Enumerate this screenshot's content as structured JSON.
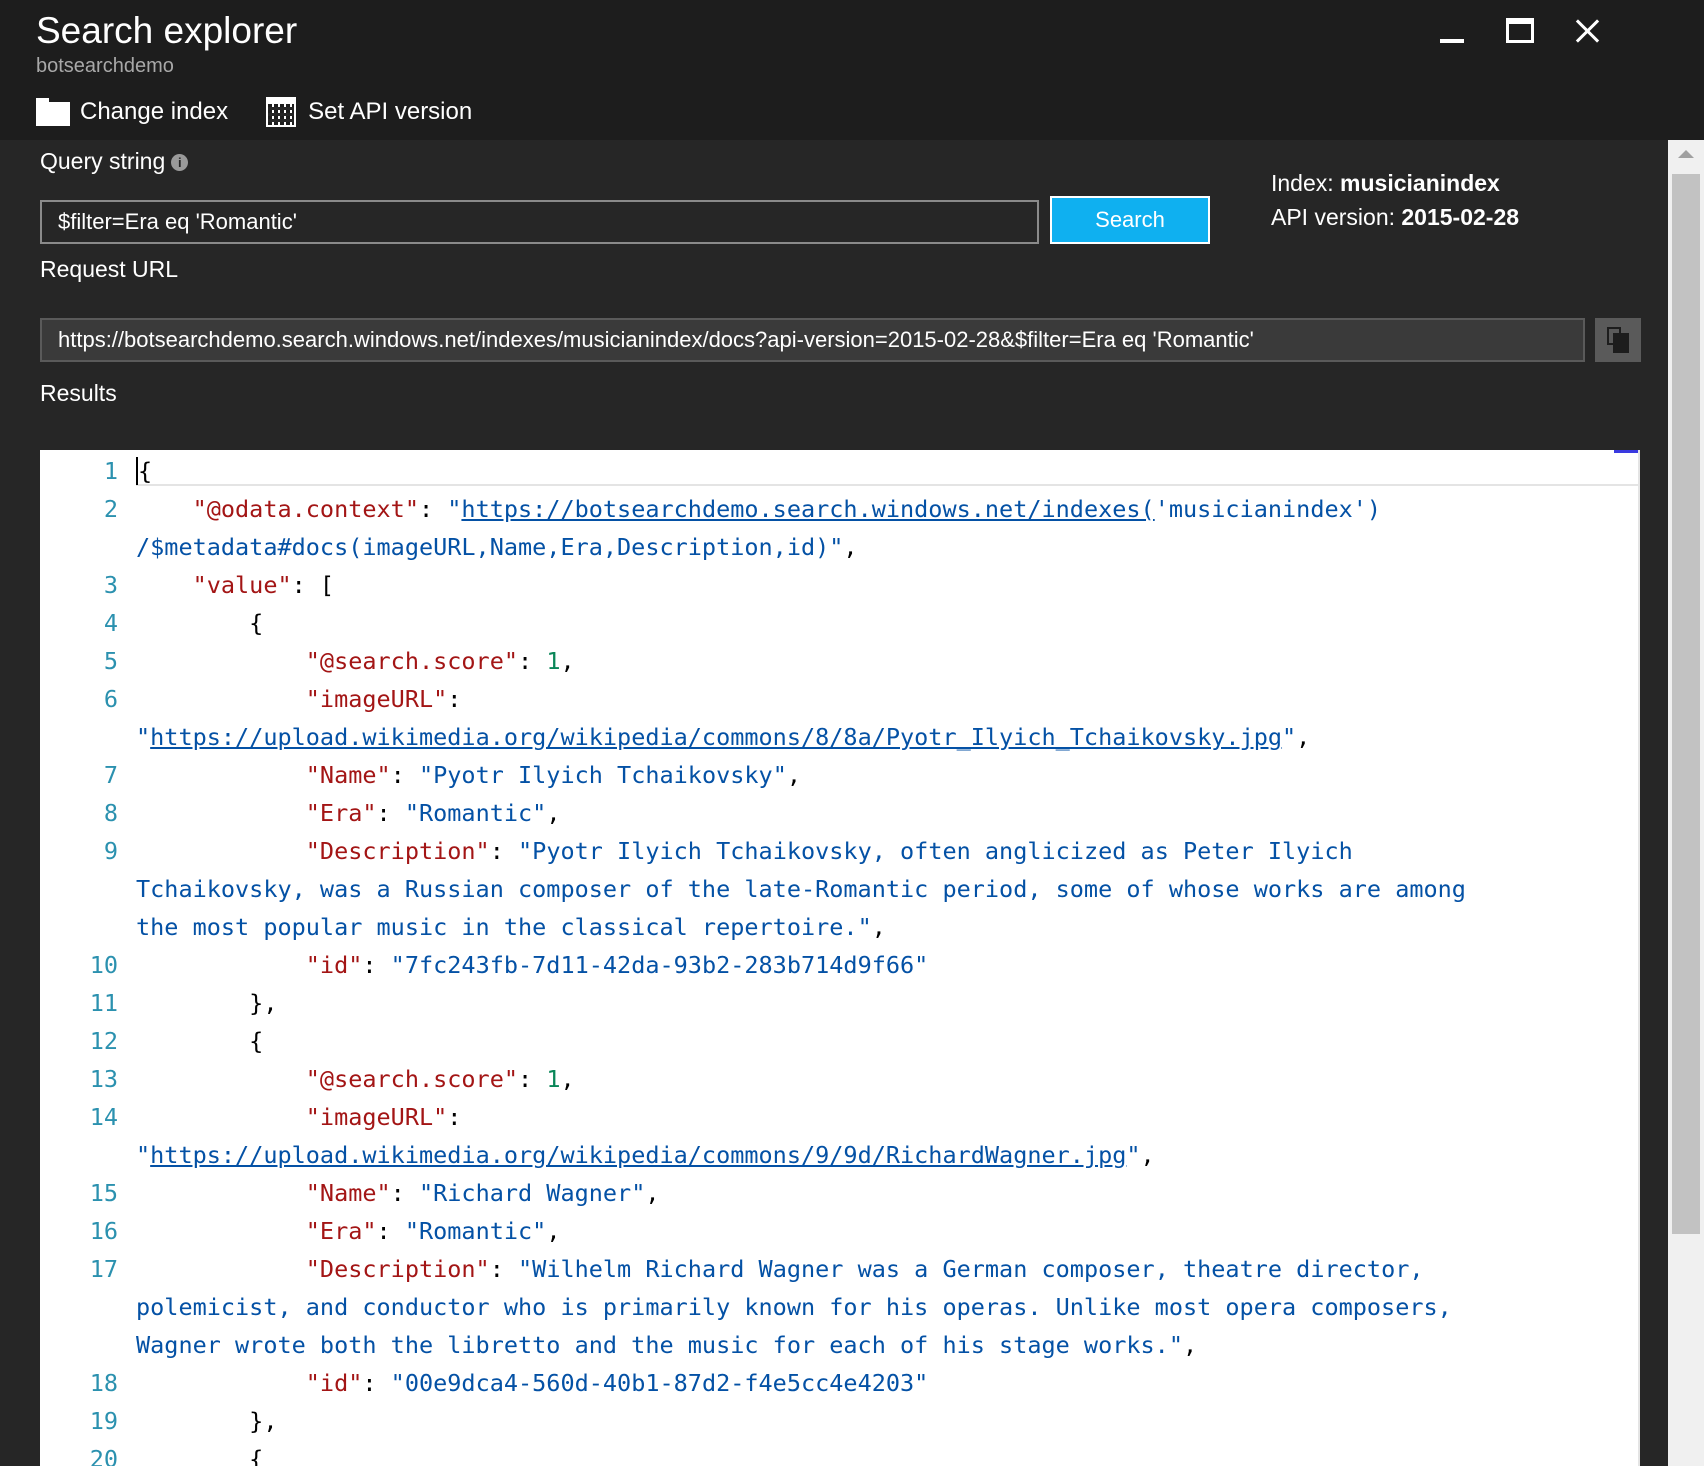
{
  "window": {
    "title": "Search explorer",
    "subtitle": "botsearchdemo",
    "controls": [
      "minimize-icon",
      "maximize-icon",
      "close-icon"
    ]
  },
  "toolbar": {
    "change_index_label": "Change index",
    "change_index_icon": "folder-icon",
    "set_api_label": "Set API version",
    "set_api_icon": "calendar-icon"
  },
  "query": {
    "label": "Query string",
    "value": "$filter=Era eq 'Romantic'",
    "search_label": "Search"
  },
  "meta": {
    "index_label": "Index:",
    "index_value": "musicianindex",
    "api_label": "API version:",
    "api_value": "2015-02-28"
  },
  "request": {
    "label": "Request URL",
    "url": "https://botsearchdemo.search.windows.net/indexes/musicianindex/docs?api-version=2015-02-28&$filter=Era eq 'Romantic'",
    "copy_icon": "copy-icon"
  },
  "results": {
    "label": "Results",
    "line_numbers": [
      "1",
      "2",
      "3",
      "4",
      "5",
      "6",
      "7",
      "8",
      "9",
      "10",
      "11",
      "12",
      "13",
      "14",
      "15",
      "16",
      "17",
      "18",
      "19",
      "20"
    ],
    "context_url_part1": "https://botsearchdemo.search.windows.net/indexes(",
    "context_url_part2": "'musicianindex')",
    "context_url_part3": "/$metadata#docs(imageURL,Name,Era,Description,id)",
    "items": [
      {
        "score": "1",
        "imageURL": "https://upload.wikimedia.org/wikipedia/commons/8/8a/Pyotr_Ilyich_Tchaikovsky.jpg",
        "name": "Pyotr Ilyich Tchaikovsky",
        "era": "Romantic",
        "desc_line1": "Pyotr Ilyich Tchaikovsky, often anglicized as Peter Ilyich",
        "desc_line2": "Tchaikovsky, was a Russian composer of the late-Romantic period, some of whose works are among",
        "desc_line3": "the most popular music in the classical repertoire.",
        "id": "7fc243fb-7d11-42da-93b2-283b714d9f66"
      },
      {
        "score": "1",
        "imageURL": "https://upload.wikimedia.org/wikipedia/commons/9/9d/RichardWagner.jpg",
        "name": "Richard Wagner",
        "era": "Romantic",
        "desc_line1": "Wilhelm Richard Wagner was a German composer, theatre director,",
        "desc_line2": "polemicist, and conductor who is primarily known for his operas. Unlike most opera composers,",
        "desc_line3": "Wagner wrote both the libretto and the music for each of his stage works.",
        "id": "00e9dca4-560d-40b1-87d2-f4e5cc4e4203"
      }
    ]
  }
}
